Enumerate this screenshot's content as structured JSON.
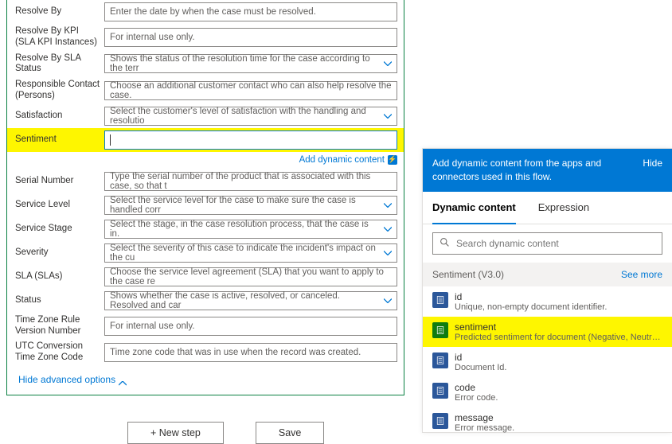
{
  "form": {
    "rows": [
      {
        "label": "Resolve By",
        "value": "Enter the date by when the case must be resolved.",
        "select": false
      },
      {
        "label": "Resolve By KPI (SLA KPI Instances)",
        "value": "For internal use only.",
        "select": false
      },
      {
        "label": "Resolve By SLA Status",
        "value": "Shows the status of the resolution time for the case according to the terr",
        "select": true
      },
      {
        "label": "Responsible Contact (Persons)",
        "value": "Choose an additional customer contact who can also help resolve the case.",
        "select": false
      },
      {
        "label": "Satisfaction",
        "value": "Select the customer's level of satisfaction with the handling and resolutio",
        "select": true
      },
      {
        "label": "Sentiment",
        "value": "",
        "select": false,
        "highlight": true
      },
      {
        "label": "Serial Number",
        "value": "Type the serial number of the product that is associated with this case, so that t",
        "select": false
      },
      {
        "label": "Service Level",
        "value": "Select the service level for the case to make sure the case is handled corr",
        "select": true
      },
      {
        "label": "Service Stage",
        "value": "Select the stage, in the case resolution process, that the case is in.",
        "select": true
      },
      {
        "label": "Severity",
        "value": "Select the severity of this case to indicate the incident's impact on the cu",
        "select": true
      },
      {
        "label": "SLA (SLAs)",
        "value": "Choose the service level agreement (SLA) that you want to apply to the case re",
        "select": false
      },
      {
        "label": "Status",
        "value": "Shows whether the case is active, resolved, or canceled. Resolved and car",
        "select": true
      },
      {
        "label": "Time Zone Rule Version Number",
        "value": "For internal use only.",
        "select": false
      },
      {
        "label": "UTC Conversion Time Zone Code",
        "value": "Time zone code that was in use when the record was created.",
        "select": false
      }
    ],
    "addDynamic": "Add dynamic content",
    "hideAdvanced": "Hide advanced options"
  },
  "buttons": {
    "newStep": "+ New step",
    "save": "Save"
  },
  "rightPanel": {
    "header": "Add dynamic content from the apps and connectors used in this flow.",
    "hide": "Hide",
    "tabs": {
      "dynamic": "Dynamic content",
      "expression": "Expression"
    },
    "searchPlaceholder": "Search dynamic content",
    "section": {
      "title": "Sentiment (V3.0)",
      "seeMore": "See more"
    },
    "items": [
      {
        "title": "id",
        "desc": "Unique, non-empty document identifier.",
        "color": "blue"
      },
      {
        "title": "sentiment",
        "desc": "Predicted sentiment for document (Negative, Neutral, Po...",
        "color": "green",
        "highlight": true
      },
      {
        "title": "id",
        "desc": "Document Id.",
        "color": "blue"
      },
      {
        "title": "code",
        "desc": "Error code.",
        "color": "blue"
      },
      {
        "title": "message",
        "desc": "Error message.",
        "color": "blue"
      }
    ]
  }
}
